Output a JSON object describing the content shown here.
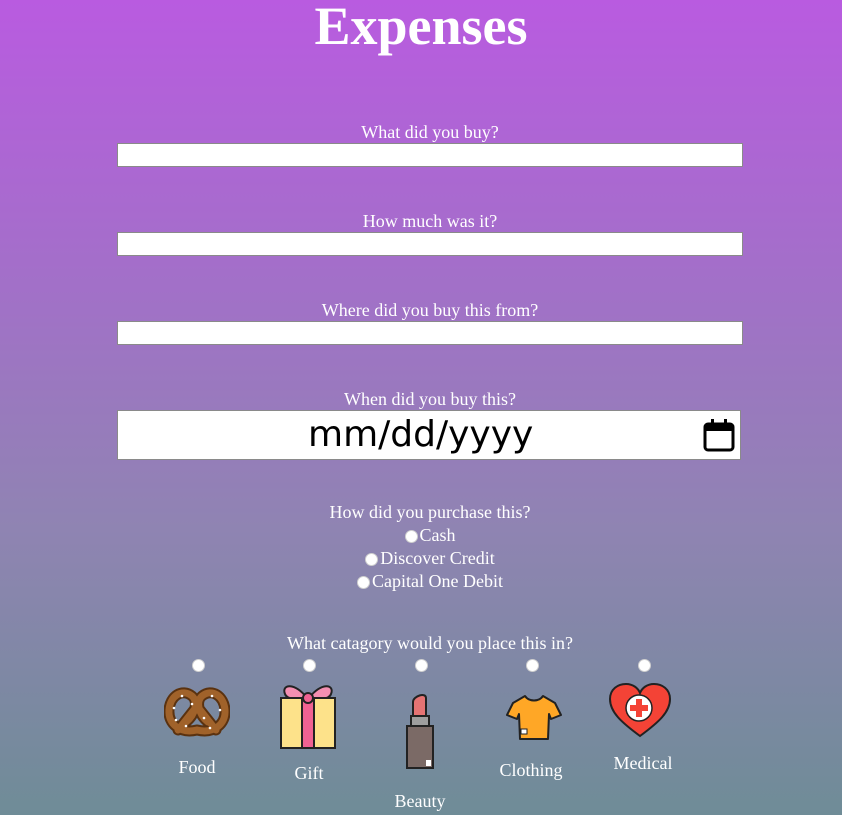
{
  "title": "Expenses",
  "fields": {
    "item_label": "What did you buy?",
    "item_value": "",
    "amount_label": "How much was it?",
    "amount_value": "",
    "store_label": "Where did you buy this from?",
    "store_value": "",
    "date_label": "When did you buy this?",
    "date_placeholder": "mm/dd/yyyy"
  },
  "payment": {
    "label": "How did you purchase this?",
    "options": [
      "Cash",
      "Discover Credit",
      "Capital One Debit"
    ]
  },
  "category": {
    "label": "What catagory would you place this in?",
    "options": [
      {
        "label": "Food",
        "icon": "pretzel-icon"
      },
      {
        "label": "Gift",
        "icon": "gift-icon"
      },
      {
        "label": "Beauty",
        "icon": "lipstick-icon"
      },
      {
        "label": "Clothing",
        "icon": "shirt-icon"
      },
      {
        "label": "Medical",
        "icon": "medical-heart-icon"
      }
    ]
  }
}
